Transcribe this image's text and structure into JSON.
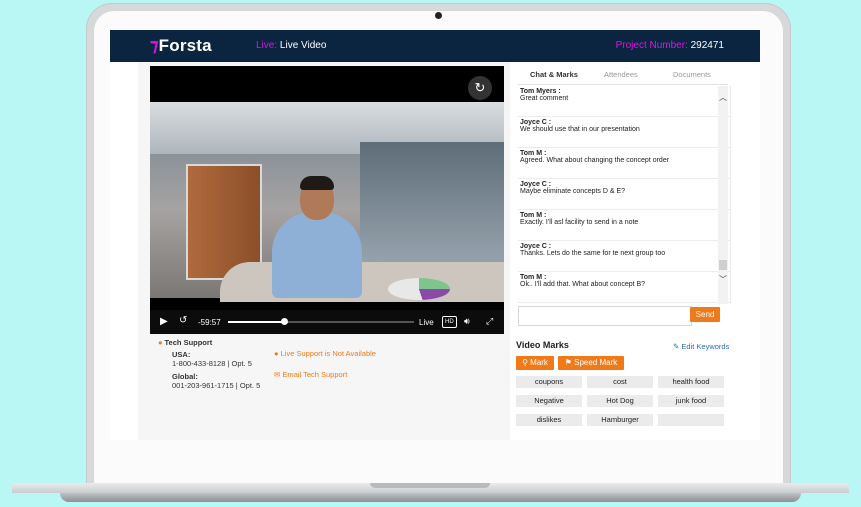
{
  "header": {
    "brand": "Forsta",
    "live_label": "Live:",
    "live_title": "Live Video",
    "project_label": "Project Number:",
    "project_number": "292471"
  },
  "player": {
    "time": "-59:57",
    "progress": 0.3,
    "live_label": "Live",
    "hd_label": "HD"
  },
  "support": {
    "title": "Tech Support",
    "usa_label": "USA:",
    "usa_phone": "1-800-433-8128 | Opt. 5",
    "global_label": "Global:",
    "global_phone": "001-203-961-1715 | Opt. 5",
    "live_support": "Live Support is Not Available",
    "email_support": "Email Tech Support"
  },
  "tabs": [
    "Chat & Marks",
    "Attendees",
    "Documents"
  ],
  "chat": [
    {
      "who": "Tom Myers :",
      "text": "Great comment"
    },
    {
      "who": "Joyce C :",
      "text": "We should use that in our presentation"
    },
    {
      "who": "Tom M :",
      "text": "Agreed. What about changing the concept order"
    },
    {
      "who": "Joyce C :",
      "text": "Maybe eliminate concepts D & E?"
    },
    {
      "who": "Tom M :",
      "text": "Exactly. I'll asl facility to send in a note"
    },
    {
      "who": "Joyce C :",
      "text": "Thanks. Lets do the same for te next group too"
    },
    {
      "who": "Tom M :",
      "text": "Ok.. I'll add that. What about concept B?"
    }
  ],
  "chat_input": {
    "value": ""
  },
  "send_label": "Send",
  "video_marks": {
    "title": "Video Marks",
    "edit_keywords": "Edit Keywords",
    "mark_label": "Mark",
    "speed_mark_label": "Speed Mark",
    "keywords": [
      "coupons",
      "cost",
      "health food",
      "Negative",
      "Hot Dog",
      "junk food",
      "dislikes",
      "Hamburger",
      ""
    ]
  },
  "colors": {
    "header_bg": "#0b2541",
    "accent_magenta": "#d617e0",
    "accent_orange": "#f07a1a",
    "link_blue": "#2d6db5",
    "background": "#b9f7f4"
  }
}
